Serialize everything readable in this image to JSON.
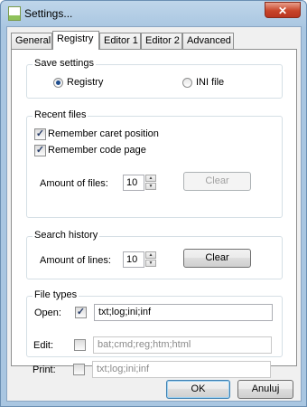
{
  "window": {
    "title": "Settings...",
    "close_glyph": "✕",
    "icon": "settings-app-icon"
  },
  "tabs": [
    {
      "label": "General",
      "active": false
    },
    {
      "label": "Registry",
      "active": true
    },
    {
      "label": "Editor 1",
      "active": false
    },
    {
      "label": "Editor 2",
      "active": false
    },
    {
      "label": "Advanced",
      "active": false
    }
  ],
  "save_settings": {
    "title": "Save settings",
    "registry_label": "Registry",
    "ini_label": "INI file",
    "selected": "Registry"
  },
  "recent_files": {
    "title": "Recent files",
    "remember_caret_label": "Remember caret position",
    "remember_caret_checked": true,
    "remember_codepage_label": "Remember code page",
    "remember_codepage_checked": true,
    "amount_label": "Amount of files:",
    "amount_value": "10",
    "clear_label": "Clear",
    "clear_enabled": false
  },
  "search_history": {
    "title": "Search history",
    "amount_label": "Amount of lines:",
    "amount_value": "10",
    "clear_label": "Clear",
    "clear_enabled": true
  },
  "file_types": {
    "title": "File types",
    "open_label": "Open:",
    "open_checked": true,
    "open_value": "txt;log;ini;inf",
    "edit_label": "Edit:",
    "edit_checked": false,
    "edit_value": "bat;cmd;reg;htm;html",
    "print_label": "Print:",
    "print_checked": false,
    "print_value": "txt;log;ini;inf"
  },
  "footer": {
    "ok_label": "OK",
    "cancel_label": "Anuluj"
  },
  "glyphs": {
    "check": "✓",
    "up": "▲",
    "down": "▼"
  },
  "colors": {
    "titlebar": "#a9c6e1",
    "close": "#c8452a",
    "accent": "#3c7fb1"
  }
}
